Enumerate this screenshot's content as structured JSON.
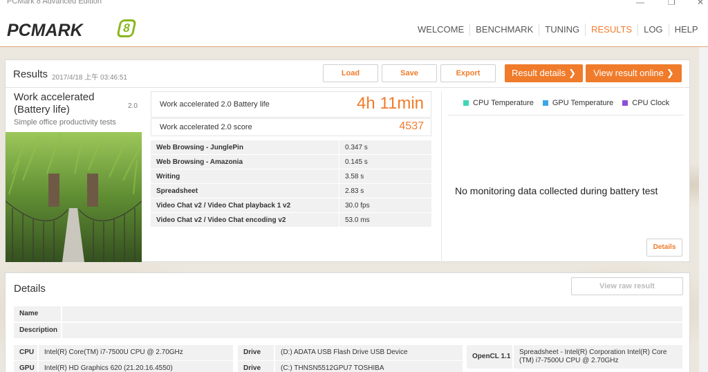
{
  "window": {
    "title": "PCMark 8 Advanced Edition",
    "minimize_glyph": "—",
    "restore_glyph": "❐",
    "close_glyph": "✕"
  },
  "header": {
    "logo_text": "PCMARK",
    "logo_badge": "8",
    "nav": [
      {
        "label": "WELCOME"
      },
      {
        "label": "BENCHMARK"
      },
      {
        "label": "TUNING"
      },
      {
        "label": "RESULTS"
      },
      {
        "label": "LOG"
      },
      {
        "label": "HELP"
      }
    ],
    "active": "RESULTS"
  },
  "results": {
    "title": "Results",
    "date": "2017/4/18 上午 03:46:51",
    "buttons": {
      "load": "Load",
      "save": "Save",
      "export": "Export",
      "result_details": "Result details",
      "view_online": "View result online",
      "chevron": "❯"
    },
    "test": {
      "name_line1": "Work accelerated",
      "name_line2": "(Battery life)",
      "version": "2.0",
      "subtitle": "Simple office productivity tests"
    },
    "battery_label": "Work accelerated 2.0 Battery life",
    "battery_value": "4h 11min",
    "score_label": "Work accelerated 2.0 score",
    "score_value": "4537",
    "subscores": [
      {
        "name": "Web Browsing - JunglePin",
        "value": "0.347 s"
      },
      {
        "name": "Web Browsing - Amazonia",
        "value": "0.145 s"
      },
      {
        "name": "Writing",
        "value": "3.58 s"
      },
      {
        "name": "Spreadsheet",
        "value": "2.83 s"
      },
      {
        "name": "Video Chat v2 / Video Chat playback 1 v2",
        "value": "30.0 fps"
      },
      {
        "name": "Video Chat v2 / Video Chat encoding v2",
        "value": "53.0 ms"
      }
    ],
    "monitoring": {
      "legend": [
        {
          "label": "CPU Temperature",
          "color": "#3dd6b5"
        },
        {
          "label": "GPU Temperature",
          "color": "#3aa7e8"
        },
        {
          "label": "CPU Clock",
          "color": "#8a4fd8"
        }
      ],
      "message": "No monitoring data collected during battery test",
      "details_button": "Details"
    }
  },
  "details": {
    "title": "Details",
    "view_raw_button": "View raw result",
    "name_label": "Name",
    "name_value": "",
    "description_label": "Description",
    "description_value": "",
    "cpu_label": "CPU",
    "cpu_value": "Intel(R) Core(TM) i7-7500U CPU @ 2.70GHz",
    "gpu_label": "GPU",
    "gpu_value": "Intel(R) HD Graphics 620 (21.20.16.4550)",
    "drive1_label": "Drive",
    "drive1_value": "(D:) ADATA USB Flash Drive USB Device",
    "drive2_label": "Drive",
    "drive2_value": "(C:) THNSN5512GPU7 TOSHIBA",
    "opencl_label": "OpenCL 1.1",
    "opencl_value": "Spreadsheet - Intel(R) Corporation Intel(R) Core (TM) i7-7500U CPU @ 2.70GHz"
  }
}
